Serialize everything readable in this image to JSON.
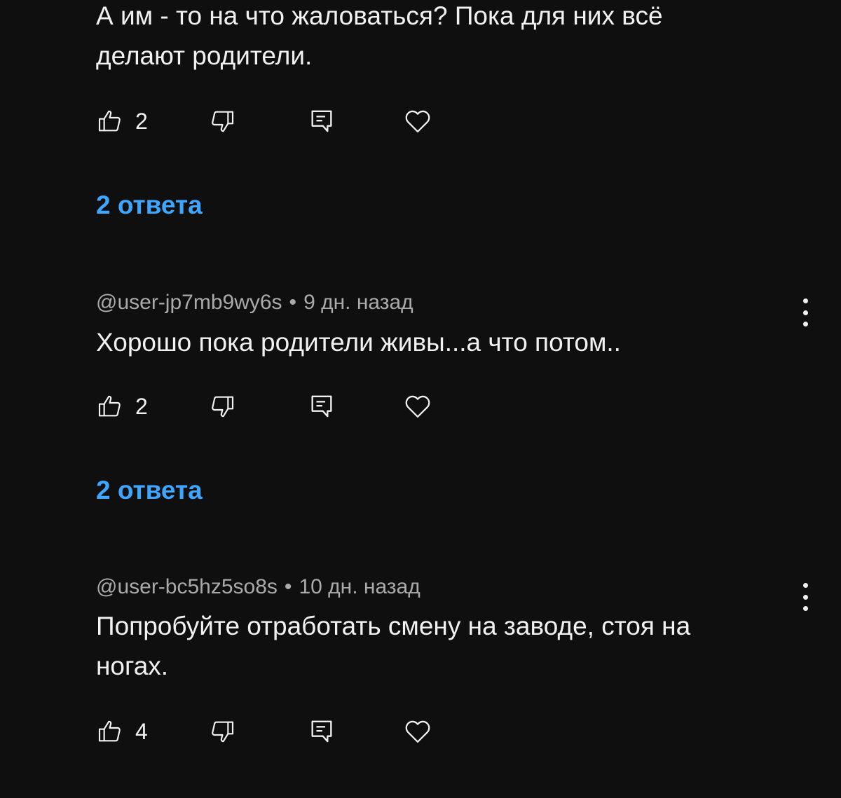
{
  "comments": [
    {
      "author": "",
      "time": "",
      "text": "А им - то на что жаловаться? Пока для них всё\nделают родители.",
      "likes": "2",
      "replies_label": "2 ответа"
    },
    {
      "author": "@user-jp7mb9wy6s",
      "separator": "•",
      "time": "9 дн. назад",
      "text": "Хорошо пока родители живы...а что потом..",
      "likes": "2",
      "replies_label": "2 ответа"
    },
    {
      "author": "@user-bc5hz5so8s",
      "separator": "•",
      "time": "10 дн. назад",
      "text": "Попробуйте отработать смену на заводе, стоя на\nногах.",
      "likes": "4"
    }
  ],
  "icons": {
    "like": "thumbs-up-icon",
    "dislike": "thumbs-down-icon",
    "reply": "reply-comment-icon",
    "heart": "heart-icon",
    "more": "more-vertical-icon"
  },
  "colors": {
    "background": "#0f0f0f",
    "text": "#f1f1f1",
    "meta": "#aaaaaa",
    "link": "#3ea6ff"
  }
}
